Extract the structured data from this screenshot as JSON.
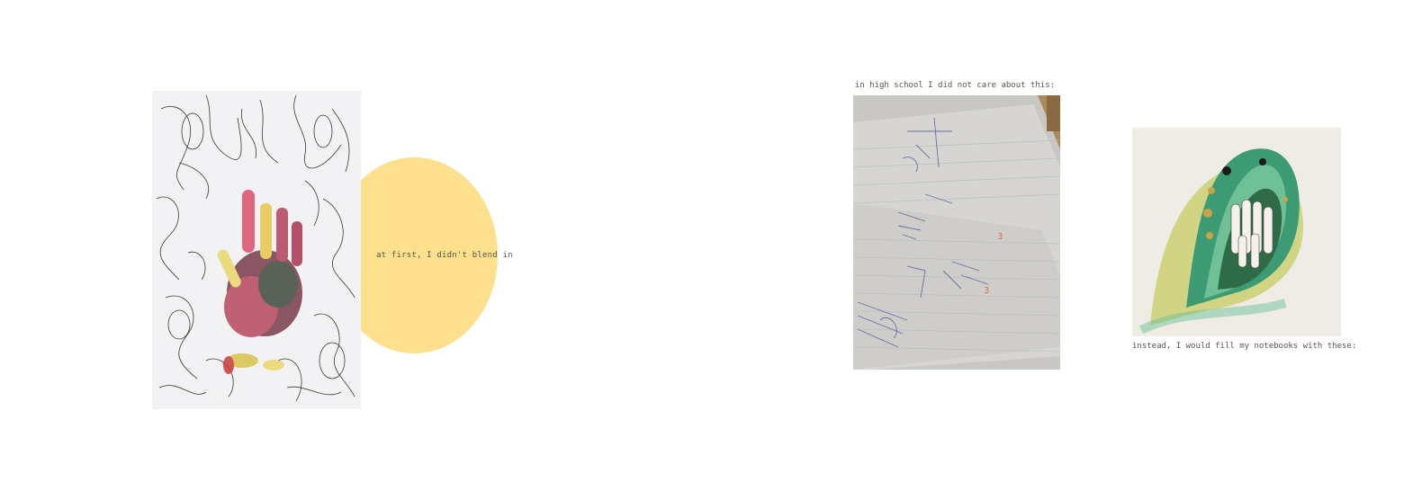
{
  "captions": {
    "blend_in": "at first, I didn't blend in",
    "high_school": "in high school I did not care about this:",
    "notebooks": "instead, I would fill my notebooks with these:"
  },
  "colors": {
    "circle": "#fde08d",
    "page_background": "#ffffff"
  },
  "images": {
    "hand_drawing": "ink drawing of many hands with a colorful painted handprint",
    "notebook_photo": "photo of math notebook pages",
    "creature_painting": "watercolor of a green toothy creature"
  }
}
